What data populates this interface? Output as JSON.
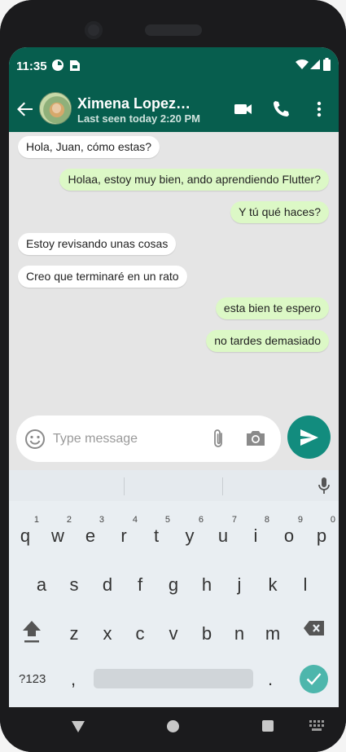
{
  "status_bar": {
    "time": "11:35"
  },
  "header": {
    "contact_name": "Ximena Lopez ...",
    "last_seen": "Last seen today 2:20 PM",
    "color": "#075e4e"
  },
  "messages": [
    {
      "text": "Hola, Juan, cómo estas?",
      "direction": "in"
    },
    {
      "text": "Holaa, estoy muy bien, ando aprendiendo Flutter?",
      "direction": "out"
    },
    {
      "text": "Y tú qué haces?",
      "direction": "out"
    },
    {
      "text": "Estoy revisando unas cosas",
      "direction": "in"
    },
    {
      "text": "Creo que terminaré en un rato",
      "direction": "in"
    },
    {
      "text": "esta bien te espero",
      "direction": "out"
    },
    {
      "text": "no tardes demasiado",
      "direction": "out"
    }
  ],
  "input": {
    "placeholder": "Type message",
    "value": ""
  },
  "keyboard": {
    "row1": [
      {
        "ch": "q",
        "num": "1"
      },
      {
        "ch": "w",
        "num": "2"
      },
      {
        "ch": "e",
        "num": "3"
      },
      {
        "ch": "r",
        "num": "4"
      },
      {
        "ch": "t",
        "num": "5"
      },
      {
        "ch": "y",
        "num": "6"
      },
      {
        "ch": "u",
        "num": "7"
      },
      {
        "ch": "i",
        "num": "8"
      },
      {
        "ch": "o",
        "num": "9"
      },
      {
        "ch": "p",
        "num": "0"
      }
    ],
    "row2": [
      "a",
      "s",
      "d",
      "f",
      "g",
      "h",
      "j",
      "k",
      "l"
    ],
    "row3": [
      "z",
      "x",
      "c",
      "v",
      "b",
      "n",
      "m"
    ],
    "symbols_label": "?123",
    "comma": ",",
    "period": "."
  },
  "colors": {
    "incoming_bubble": "#ffffff",
    "outgoing_bubble": "#dcf8c6",
    "send_button": "#128c7e",
    "enter_key": "#4db6ac"
  }
}
